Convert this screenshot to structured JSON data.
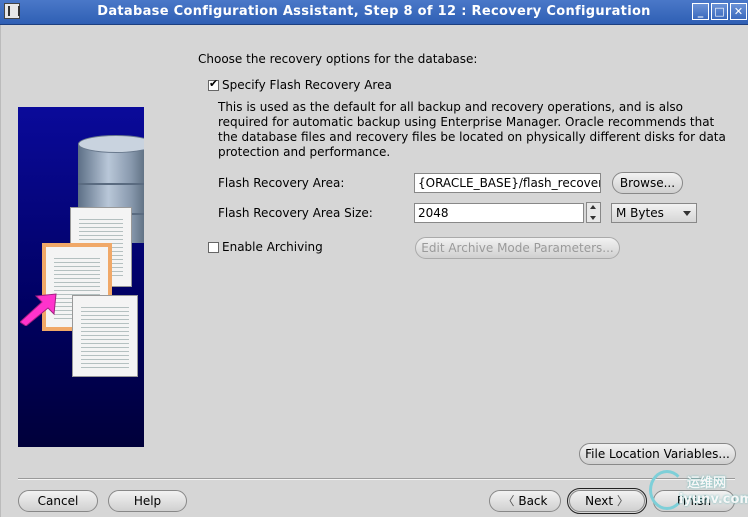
{
  "window": {
    "title": "Database Configuration Assistant, Step 8 of 12 : Recovery Configuration",
    "controls": {
      "minimize": "_",
      "maximize": "□",
      "close": "✕"
    }
  },
  "main": {
    "instruction": "Choose the recovery options for the database:",
    "flash": {
      "checkbox_label": "Specify Flash Recovery Area",
      "checked": true,
      "description": "This is used as the default for all backup and recovery operations, and is also required for automatic backup using Enterprise Manager. Oracle recommends that the database files and recovery files be located on physically different disks for data protection and performance.",
      "area_label": "Flash Recovery Area:",
      "area_value": "{ORACLE_BASE}/flash_recovery_",
      "browse_label": "Browse...",
      "size_label": "Flash Recovery Area Size:",
      "size_value": "2048",
      "unit_value": "M Bytes"
    },
    "archiving": {
      "checkbox_label": "Enable Archiving",
      "checked": false,
      "edit_params_label": "Edit Archive Mode Parameters..."
    },
    "file_location_label": "File Location Variables..."
  },
  "footer": {
    "cancel": "Cancel",
    "help": "Help",
    "back": "Back",
    "next": "Next",
    "finish": "Finish"
  },
  "watermark": {
    "line1": "运维网",
    "line2": "iyunv.com"
  },
  "colors": {
    "titlebar": "#3a69bd",
    "illustration_bg": "#000080",
    "highlight_arrow": "#ff33cc"
  }
}
